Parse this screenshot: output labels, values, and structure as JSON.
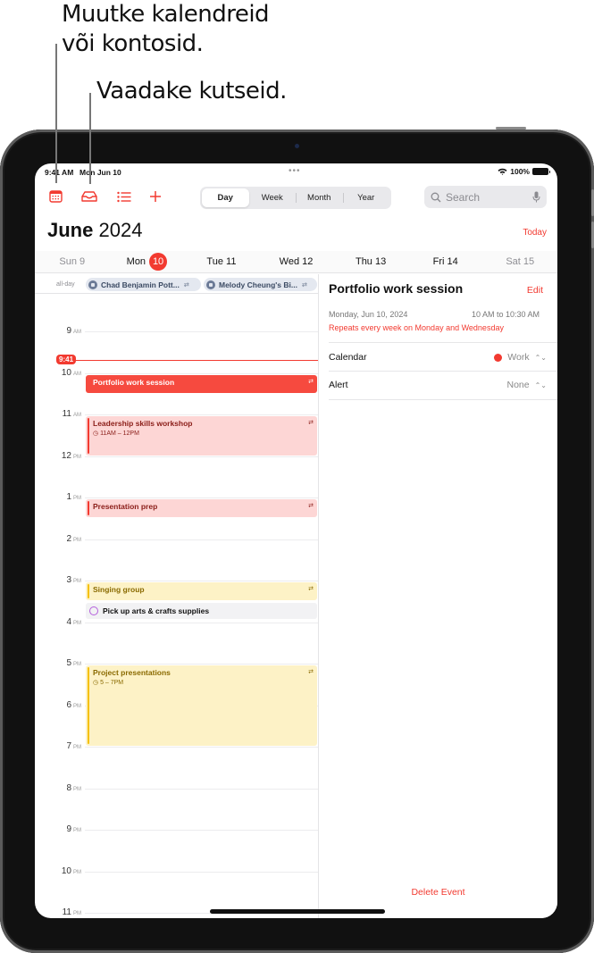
{
  "callouts": {
    "top_line1": "Muutke kalendreid",
    "top_line2": "või kontosid.",
    "second": "Vaadake kutseid."
  },
  "status_bar": {
    "time": "9:41 AM",
    "date": "Mon Jun 10",
    "dots": "•••",
    "battery": "100%"
  },
  "toolbar": {
    "icons": [
      "calendars-icon",
      "inbox-icon",
      "list-icon",
      "add-icon"
    ],
    "view_segments": [
      {
        "label": "Day",
        "active": true
      },
      {
        "label": "Week",
        "active": false
      },
      {
        "label": "Month",
        "active": false
      },
      {
        "label": "Year",
        "active": false
      }
    ],
    "search_placeholder": "Search"
  },
  "header": {
    "month": "June",
    "year": "2024",
    "today_label": "Today"
  },
  "week": [
    {
      "label": "Sun 9",
      "muted": true
    },
    {
      "label": "Mon",
      "badge": "10",
      "selected": true
    },
    {
      "label": "Tue 11"
    },
    {
      "label": "Wed 12"
    },
    {
      "label": "Thu 13"
    },
    {
      "label": "Fri 14"
    },
    {
      "label": "Sat 15",
      "muted": true
    }
  ],
  "all_day": {
    "label": "all-day",
    "events": [
      {
        "title": "Chad Benjamin Pott...",
        "icon": "birthday-icon",
        "repeat": true
      },
      {
        "title": "Melody Cheung's Bi...",
        "icon": "birthday-icon",
        "repeat": true
      }
    ]
  },
  "hours": [
    {
      "h": "9",
      "p": "AM"
    },
    {
      "h": "10",
      "p": "AM"
    },
    {
      "h": "11",
      "p": "AM"
    },
    {
      "h": "12",
      "p": "PM"
    },
    {
      "h": "1",
      "p": "PM"
    },
    {
      "h": "2",
      "p": "PM"
    },
    {
      "h": "3",
      "p": "PM"
    },
    {
      "h": "4",
      "p": "PM"
    },
    {
      "h": "5",
      "p": "PM"
    },
    {
      "h": "6",
      "p": "PM"
    },
    {
      "h": "7",
      "p": "PM"
    },
    {
      "h": "8",
      "p": "PM"
    },
    {
      "h": "9",
      "p": "PM"
    },
    {
      "h": "10",
      "p": "PM"
    },
    {
      "h": "11",
      "p": "PM"
    }
  ],
  "now": "9:41",
  "events": [
    {
      "title": "Portfolio work session",
      "time": "",
      "style": "red",
      "start": 10.0,
      "end": 10.5,
      "repeat": true
    },
    {
      "title": "Leadership skills workshop",
      "time": "11AM – 12PM",
      "style": "pink",
      "start": 11.0,
      "end": 12.0,
      "repeat": true
    },
    {
      "title": "Presentation prep",
      "time": "",
      "style": "pink",
      "start": 13.0,
      "end": 13.5,
      "repeat": true
    },
    {
      "title": "Singing group",
      "time": "",
      "style": "yellow",
      "start": 15.0,
      "end": 15.5,
      "repeat": true
    },
    {
      "title": "Pick up arts & crafts supplies",
      "time": "",
      "style": "reminder",
      "start": 15.5,
      "end": 15.75,
      "repeat": false
    },
    {
      "title": "Project presentations",
      "time": "5 – 7PM",
      "style": "yellow",
      "start": 17.0,
      "end": 19.0,
      "repeat": true
    }
  ],
  "detail": {
    "title": "Portfolio work session",
    "edit_label": "Edit",
    "date": "Monday, Jun 10, 2024",
    "time": "10 AM to 10:30 AM",
    "repeat": "Repeats every week on Monday and Wednesday",
    "calendar_label": "Calendar",
    "calendar_value": "Work",
    "calendar_color": "#f23a30",
    "alert_label": "Alert",
    "alert_value": "None",
    "delete_label": "Delete Event"
  }
}
